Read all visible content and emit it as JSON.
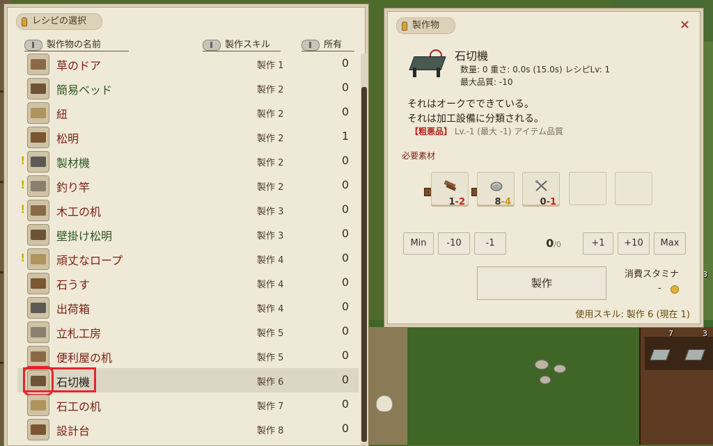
{
  "recipe_panel": {
    "tab_title": "レシピの選択",
    "col_name": "製作物の名前",
    "col_skill": "製作スキル",
    "col_owned": "所有",
    "rows": [
      {
        "name": "草のドア",
        "skill": "製作 1",
        "owned": "0",
        "color": "red",
        "alert": false
      },
      {
        "name": "簡易ベッド",
        "skill": "製作 2",
        "owned": "0",
        "color": "green",
        "alert": false
      },
      {
        "name": "紐",
        "skill": "製作 2",
        "owned": "0",
        "color": "red",
        "alert": false
      },
      {
        "name": "松明",
        "skill": "製作 2",
        "owned": "1",
        "color": "red",
        "alert": false
      },
      {
        "name": "製材機",
        "skill": "製作 2",
        "owned": "0",
        "color": "green",
        "alert": true
      },
      {
        "name": "釣り竿",
        "skill": "製作 2",
        "owned": "0",
        "color": "red",
        "alert": true
      },
      {
        "name": "木工の机",
        "skill": "製作 3",
        "owned": "0",
        "color": "red",
        "alert": true
      },
      {
        "name": "壁掛け松明",
        "skill": "製作 3",
        "owned": "0",
        "color": "green",
        "alert": false
      },
      {
        "name": "頑丈なロープ",
        "skill": "製作 4",
        "owned": "0",
        "color": "red",
        "alert": true
      },
      {
        "name": "石うす",
        "skill": "製作 4",
        "owned": "0",
        "color": "red",
        "alert": false
      },
      {
        "name": "出荷箱",
        "skill": "製作 4",
        "owned": "0",
        "color": "red",
        "alert": false
      },
      {
        "name": "立札工房",
        "skill": "製作 5",
        "owned": "0",
        "color": "red",
        "alert": false
      },
      {
        "name": "便利屋の机",
        "skill": "製作 5",
        "owned": "0",
        "color": "red",
        "alert": false
      },
      {
        "name": "石切機",
        "skill": "製作 6",
        "owned": "0",
        "color": "black",
        "alert": false,
        "selected": true
      },
      {
        "name": "石工の机",
        "skill": "製作 7",
        "owned": "0",
        "color": "red",
        "alert": false
      },
      {
        "name": "設計台",
        "skill": "製作 8",
        "owned": "0",
        "color": "red",
        "alert": false
      }
    ]
  },
  "detail_panel": {
    "tab_title": "製作物",
    "close_label": "×",
    "item_name": "石切機",
    "stats_line1": "数量: 0  重さ: 0.0s (15.0s)  レシピLv: 1",
    "stats_line2": "最大品質: -10",
    "desc_line1": "それはオークでできている。",
    "desc_line2": "それは加工設備に分類される。",
    "quality_tag": "【粗悪品】",
    "quality_text": "Lv.-1 (最大 -1) アイテム品質",
    "materials_label": "必要素材",
    "materials": [
      {
        "icon": "log-icon",
        "have": "1",
        "need": "-2",
        "need_color": "red"
      },
      {
        "icon": "stone-icon",
        "have": "8",
        "need": "-4",
        "need_color": "gold"
      },
      {
        "icon": "tools-icon",
        "have": "0",
        "need": "-1",
        "need_color": "red"
      }
    ],
    "buttons": {
      "min": "Min",
      "minus10": "-10",
      "minus1": "-1",
      "plus1": "+1",
      "plus10": "+10",
      "max": "Max"
    },
    "qty_value": "0",
    "qty_max": "/0",
    "craft_label": "製作",
    "stamina_label": "消費スタミナ",
    "stamina_value": "-",
    "use_skill": "使用スキル: 製作 6 (現在 1)"
  },
  "world": {
    "counts": [
      "3",
      "7",
      "3"
    ]
  }
}
